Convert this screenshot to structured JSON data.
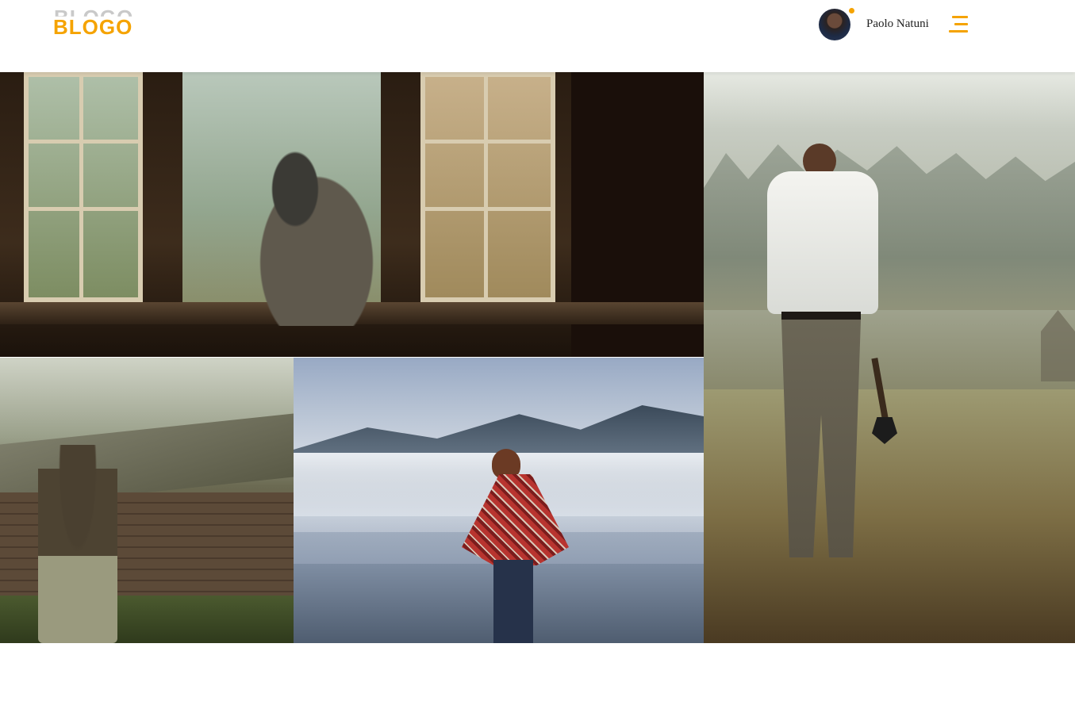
{
  "header": {
    "logo_text": "BLOGO",
    "logo_shadow_text": "BLOGO",
    "user": {
      "name": "Paolo Natuni",
      "status_color": "#f5a300"
    },
    "menu_icon": "hamburger-menu-icon",
    "accent_color": "#f5a300"
  },
  "gallery": {
    "tiles": [
      {
        "subject": "window-scene-photo"
      },
      {
        "subject": "ruined-house-photo"
      },
      {
        "subject": "misty-lake-photo"
      },
      {
        "subject": "man-with-axe-photo"
      }
    ]
  }
}
